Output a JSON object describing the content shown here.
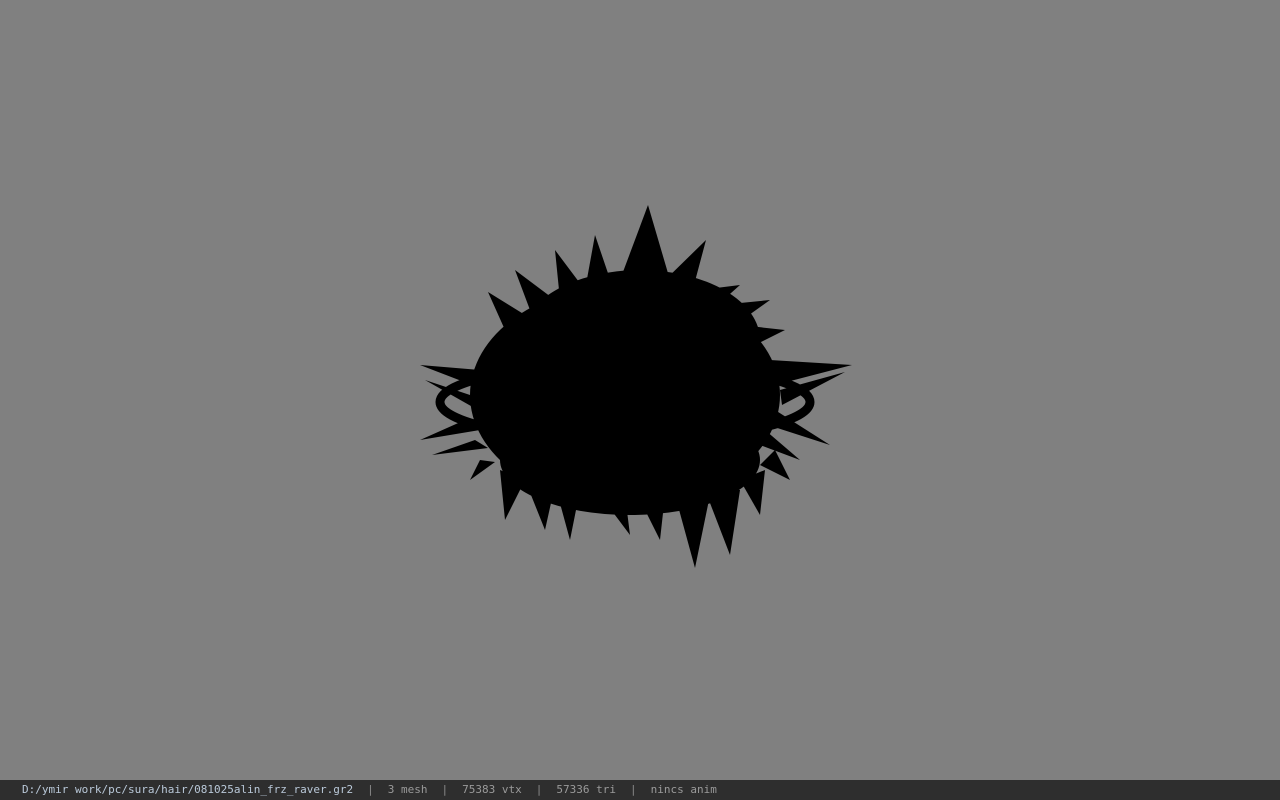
{
  "viewer": {
    "background_color": "#808080",
    "model_color": "#000000",
    "model_description_icon": "hair-mesh-silhouette"
  },
  "status": {
    "file_path": "D:/ymir work/pc/sura/hair/081025alin_frz_raver.gr2",
    "separator": "|",
    "mesh_count": "3 mesh",
    "vertex_count": "75383 vtx",
    "triangle_count": "57336 tri",
    "anim": "nincs anim"
  }
}
